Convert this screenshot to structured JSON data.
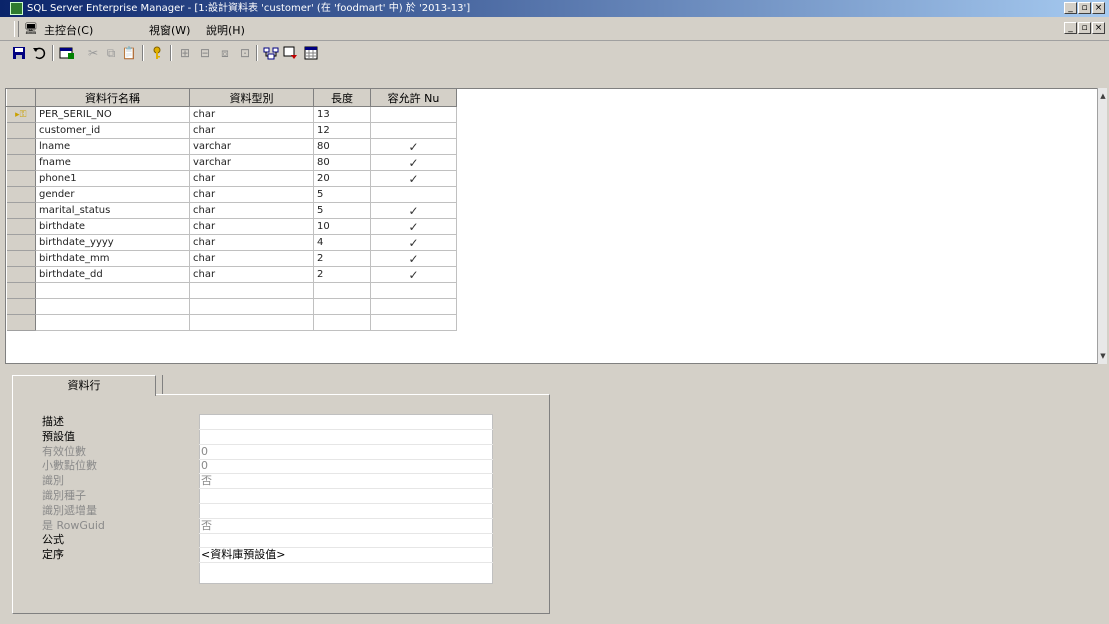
{
  "window": {
    "title": "SQL Server Enterprise Manager - [1:設計資料表 'customer' (在 'foodmart' 中) 於 '2013-13']",
    "controls": [
      "_",
      "▫",
      "×"
    ]
  },
  "menubar": {
    "items": [
      "主控台(C)",
      "視窗(W)",
      "說明(H)"
    ]
  },
  "toolbar": {
    "icons": [
      "save-icon",
      "undo-icon",
      "properties-icon",
      "cut-icon",
      "copy-icon",
      "paste-icon",
      "primary-key-icon",
      "insert-column-icon",
      "delete-column-icon",
      "relationships-icon",
      "indexes-icon",
      "constraints-icon",
      "generate-script-icon",
      "table-icon"
    ]
  },
  "grid": {
    "columns": [
      "資料行名稱",
      "資料型別",
      "長度",
      "容允許 Nu"
    ],
    "rows": [
      {
        "name": "PER_SERIL_NO",
        "type": "char",
        "length": "13",
        "nullable": "",
        "key": true
      },
      {
        "name": "customer_id",
        "type": "char",
        "length": "12",
        "nullable": ""
      },
      {
        "name": "lname",
        "type": "varchar",
        "length": "80",
        "nullable": "✓"
      },
      {
        "name": "fname",
        "type": "varchar",
        "length": "80",
        "nullable": "✓"
      },
      {
        "name": "phone1",
        "type": "char",
        "length": "20",
        "nullable": "✓"
      },
      {
        "name": "gender",
        "type": "char",
        "length": "5",
        "nullable": ""
      },
      {
        "name": "marital_status",
        "type": "char",
        "length": "5",
        "nullable": "✓"
      },
      {
        "name": "birthdate",
        "type": "char",
        "length": "10",
        "nullable": "✓"
      },
      {
        "name": "birthdate_yyyy",
        "type": "char",
        "length": "4",
        "nullable": "✓"
      },
      {
        "name": "birthdate_mm",
        "type": "char",
        "length": "2",
        "nullable": "✓"
      },
      {
        "name": "birthdate_dd",
        "type": "char",
        "length": "2",
        "nullable": "✓"
      },
      {
        "name": "",
        "type": "",
        "length": "",
        "nullable": ""
      },
      {
        "name": "",
        "type": "",
        "length": "",
        "nullable": ""
      },
      {
        "name": "",
        "type": "",
        "length": "",
        "nullable": ""
      }
    ]
  },
  "properties": {
    "tab_label": "資料行",
    "rows": [
      {
        "label": "描述",
        "value": "",
        "disabled": false
      },
      {
        "label": "預設值",
        "value": "",
        "disabled": false
      },
      {
        "label": "有效位數",
        "value": "0",
        "disabled": true
      },
      {
        "label": "小數點位數",
        "value": "0",
        "disabled": true
      },
      {
        "label": "識別",
        "value": "否",
        "disabled": true
      },
      {
        "label": "識別種子",
        "value": "",
        "disabled": true
      },
      {
        "label": "識別遞增量",
        "value": "",
        "disabled": true
      },
      {
        "label": "是 RowGuid",
        "value": "否",
        "disabled": true
      },
      {
        "label": "公式",
        "value": "",
        "disabled": false
      },
      {
        "label": "定序",
        "value": "<資料庫預設值>",
        "disabled": false
      }
    ]
  }
}
